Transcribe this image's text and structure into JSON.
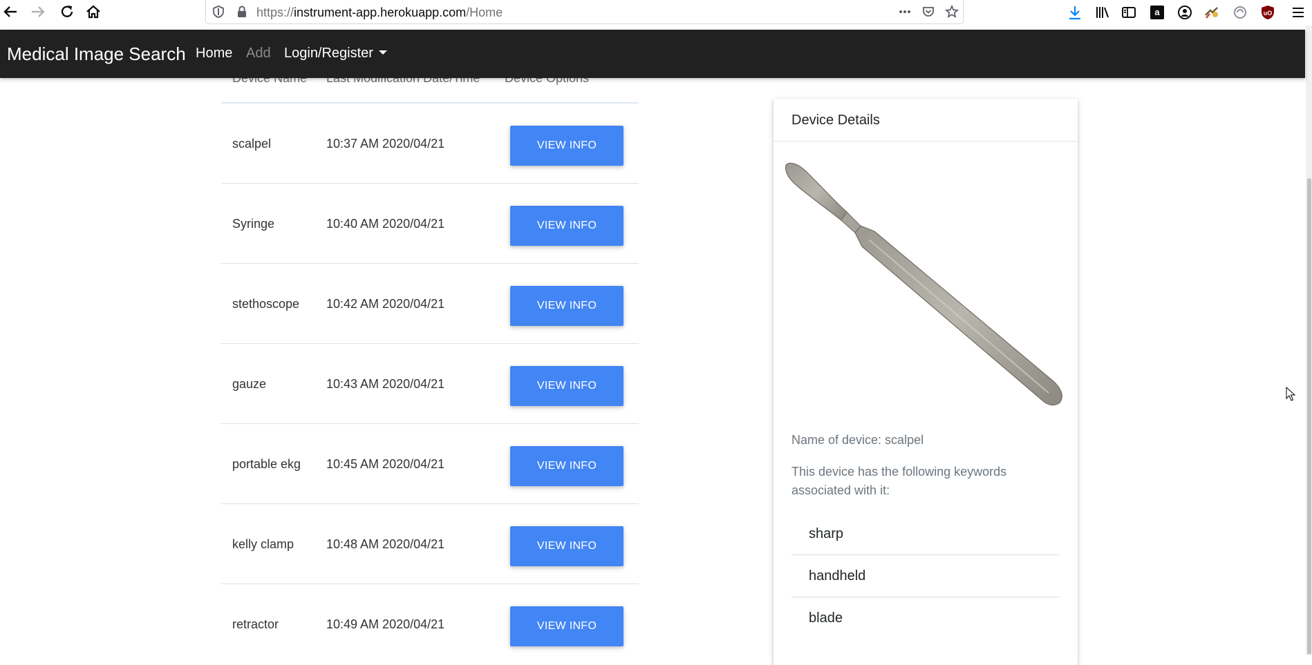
{
  "browser": {
    "url_prefix": "https://",
    "url_domain": "instrument-app.herokuapp.com",
    "url_path": "/Home"
  },
  "navbar": {
    "brand": "Medical Image Search",
    "links": [
      "Home",
      "Add",
      "Login/Register"
    ]
  },
  "table": {
    "headers": [
      "Device Name",
      "Last Modification Date/Time",
      "Device Options"
    ],
    "button_label": "VIEW INFO",
    "rows": [
      {
        "name": "scalpel",
        "time": "10:37 AM 2020/04/21"
      },
      {
        "name": "Syringe",
        "time": "10:40 AM 2020/04/21"
      },
      {
        "name": "stethoscope",
        "time": "10:42 AM 2020/04/21"
      },
      {
        "name": "gauze",
        "time": "10:43 AM 2020/04/21"
      },
      {
        "name": "portable ekg",
        "time": "10:45 AM 2020/04/21"
      },
      {
        "name": "kelly clamp",
        "time": "10:48 AM 2020/04/21"
      },
      {
        "name": "retractor",
        "time": "10:49 AM 2020/04/21"
      }
    ]
  },
  "details": {
    "title": "Device Details",
    "name_line": "Name of device: scalpel",
    "keywords_intro": "This device has the following keywords associated with it:",
    "keywords": [
      "sharp",
      "handheld",
      "blade"
    ]
  },
  "colors": {
    "navbar_bg": "#212121",
    "button_primary": "#4285f4"
  }
}
